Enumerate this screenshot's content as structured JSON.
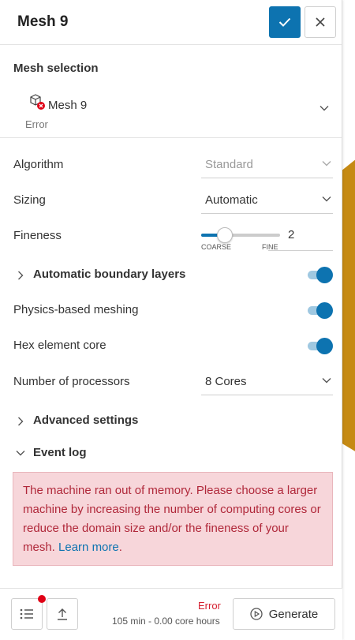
{
  "header": {
    "title": "Mesh 9"
  },
  "mesh_selection": {
    "title": "Mesh selection",
    "mesh_name": "Mesh 9",
    "mesh_status": "Error"
  },
  "fields": {
    "algorithm": {
      "label": "Algorithm",
      "value": "Standard"
    },
    "sizing": {
      "label": "Sizing",
      "value": "Automatic"
    },
    "fineness": {
      "label": "Fineness",
      "value": "2",
      "min_label": "COARSE",
      "max_label": "FINE",
      "level_fraction": 0.25
    },
    "auto_boundary_layers": {
      "label": "Automatic boundary layers",
      "enabled": true
    },
    "physics_meshing": {
      "label": "Physics-based meshing",
      "enabled": true
    },
    "hex_core": {
      "label": "Hex element core",
      "enabled": true
    },
    "processors": {
      "label": "Number of processors",
      "value": "8 Cores"
    }
  },
  "advanced_settings": {
    "label": "Advanced settings"
  },
  "event_log": {
    "label": "Event log",
    "message": "The machine ran out of memory. Please choose a larger machine by increasing the number of computing cores or reduce the domain size and/or the fineness of your mesh.",
    "link_text": "Learn more",
    "trailing": "."
  },
  "footer": {
    "status": "Error",
    "usage": "105 min - 0.00 core hours",
    "generate_label": "Generate"
  },
  "colors": {
    "accent": "#0d73b0",
    "error": "#d52030",
    "error_bg": "#f7d6da",
    "geometry": "#c58a14"
  }
}
